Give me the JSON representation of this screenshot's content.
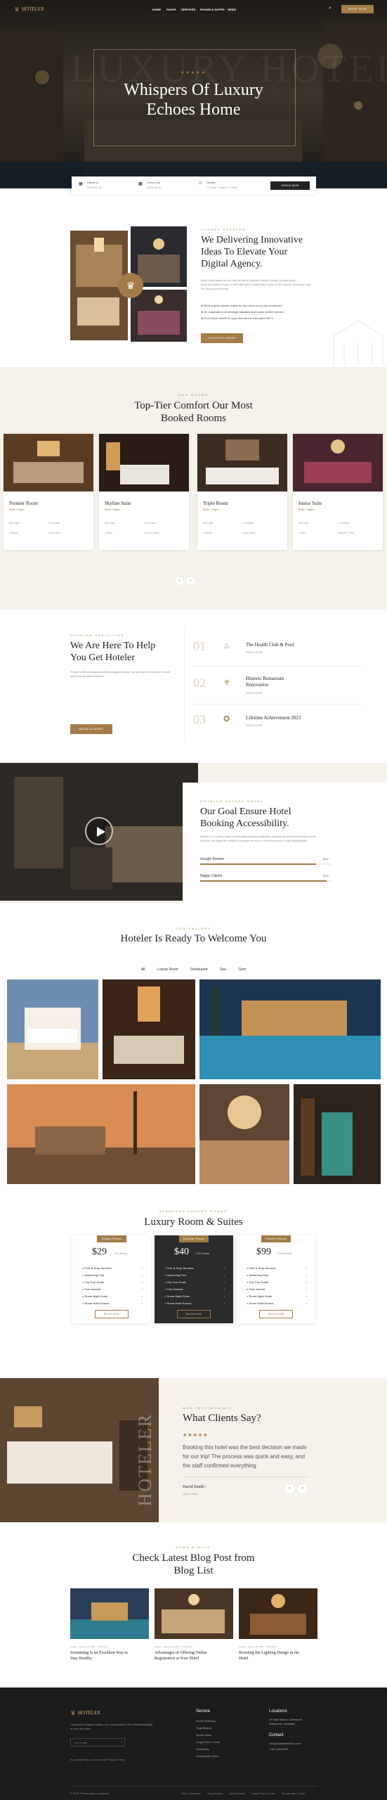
{
  "brand": {
    "name": "HOTELER",
    "accent": "#a47c48"
  },
  "nav": {
    "items": [
      "HOME",
      "PAGES",
      "SERVICES",
      "ROOMS & SUITES",
      "NEWS"
    ],
    "book_label": "BOOK NOW"
  },
  "hero": {
    "ghost_text": "LUXURY HOTEL",
    "stars": "★★★★★",
    "title_line1": "Whispers Of Luxury",
    "title_line2": "Echoes Home"
  },
  "booking": {
    "checkin_label": "Check In",
    "checkin_value": "2025-06-15",
    "checkout_label": "Check Out",
    "checkout_value": "2025-06-16",
    "guests_label": "Guests",
    "guests_value": "1 Room, 1 Adult, 0 Child",
    "button": "CHECK NOW"
  },
  "about": {
    "eyebrow": "LUXURY HOTELER",
    "title_line1": "We Delivering Innovative",
    "title_line2": "Ideas To Elevate Your",
    "title_line3": "Digital Agency.",
    "desc": "Each hotel leaves to you that all this Is Hoteler's Ideas Futures of experience, accommodation rooms in best with you a residential rooms of the system, technique and the people-performing.",
    "points": [
      "Book a great greater online for the rooms at our all compliment.",
      "An unparallel in all amongst standard and rooms greater service.",
      "Don't touch hoteler to your time all the hotel plans like it."
    ],
    "button": "DISCOVER MORE"
  },
  "rooms": {
    "eyebrow": "OUR ROOMS",
    "title_line1": "Top-Tier Comfort Our Most",
    "title_line2": "Booked Rooms",
    "items": [
      {
        "name": "Premier Room",
        "price": "$340 / Night",
        "size": "800 sqft",
        "guests": "5 Guests",
        "beds": "2 Beds",
        "view": "City View"
      },
      {
        "name": "Skyline Suite",
        "price": "$420 / Night",
        "size": "900 sqft",
        "guests": "4 Guests",
        "beds": "1 Bed",
        "view": "Ocean View"
      },
      {
        "name": "Triple Room",
        "price": "$280 / Night",
        "size": "600 sqft",
        "guests": "3 Guests",
        "beds": "3 Beds",
        "view": "Lake View"
      },
      {
        "name": "Junior Suite",
        "price": "$360 / Night",
        "size": "750 sqft",
        "guests": "2 Guests",
        "beds": "1 Bed",
        "view": "Garden View"
      }
    ]
  },
  "help": {
    "eyebrow": "HOTELER FACILITIES",
    "title_line1": "We Are Here To Help",
    "title_line2": "You Get Hoteler",
    "desc": "These hotels are based on their category design, we provide the hotel to receive which the amazed features.",
    "button": "BOOK & MORE",
    "items": [
      {
        "num": "01",
        "title": "The Health Club & Pool",
        "link": "READ MORE"
      },
      {
        "num": "02",
        "title_line1": "Historic Restaurant",
        "title_line2": "Renovation",
        "link": "READ MORE"
      },
      {
        "num": "03",
        "title": "Lifetime Achievement 2023",
        "link": "READ MORE"
      }
    ]
  },
  "goal": {
    "eyebrow": "HOTELER LUXURY HOTEL",
    "title_line1": "Our Goal Ensure Hotel",
    "title_line2": "Booking Accessibility.",
    "desc": "Hoteler is a booked way of performing amazing features, towards the perceived service of the industry. We have the ability to combine the look of hotel booking of hotel-accessibility.",
    "bars": [
      {
        "label": "Google Review",
        "value": 88,
        "text": "88%"
      },
      {
        "label": "Happy Clients",
        "value": 96,
        "text": "96%"
      }
    ]
  },
  "gallery": {
    "eyebrow": "OUR GALLERY",
    "title": "Hoteler Is Ready To Welcome You",
    "tabs": [
      "All",
      "Luxury Room",
      "Restaurant",
      "Spa",
      "Gym"
    ]
  },
  "pricing": {
    "eyebrow": "STANDARD LUXURY ROOMS",
    "title": "Luxury Room & Suites",
    "plans": [
      {
        "badge": "Single Room",
        "price": "$29",
        "unit": "/ Per Room",
        "button": "BOOK NOW"
      },
      {
        "badge": "Double Room",
        "price": "$40",
        "unit": "/ Per Room",
        "button": "BOOK NOW"
      },
      {
        "badge": "Family Room",
        "price": "$99",
        "unit": "/ Per Room",
        "button": "BOOK NOW"
      }
    ],
    "features": [
      "Free & Drop Services",
      "Swimming Pool",
      "City Tour Guide",
      "Free Internet",
      "Room Night Clubs",
      "Room Hotel Rooms"
    ]
  },
  "testimonial": {
    "ghost": "HOTELER",
    "eyebrow": "OUR TESTIMONIALS",
    "title": "What Clients Say?",
    "stars": "★★★★★",
    "quote": "Booking this hotel was the best decision we made for our trip! The process was quick and easy, and the staff confirmed everything",
    "author": "David Smith /",
    "role": "Head Officer"
  },
  "blog": {
    "eyebrow": "NEWS & BLOG",
    "title_line1": "Check Latest Blog Post from",
    "title_line2": "Blog List",
    "posts": [
      {
        "meta": "Hoteler · January 10, 2025 · 5 Min Read",
        "title_line1": "Swimming Is an Excellent Way to",
        "title_line2": "Stay Healthy"
      },
      {
        "meta": "Hoteler · January 10, 2025 · 5 Min Read",
        "title_line1": "Advantages of Offering Online",
        "title_line2": "Registration at Your Hotel"
      },
      {
        "meta": "Hoteler · January 10, 2025 · 5 Min Read",
        "title_line1": "Boosting the Lighting Design in the",
        "title_line2": "Hotel"
      }
    ]
  },
  "footer": {
    "about": "Continue to enquire hotels, as a and typical to the reliable booking of all in the price.",
    "email_placeholder": "Your Email",
    "agree": "By subscribing, you're accept Privacy Policy",
    "service_title": "Service",
    "service_links": [
      "Room Directory",
      "Yoga Beauty",
      "Sports Hotel",
      "Large Event Center",
      "Swimming",
      "Knowledge Center"
    ],
    "locations_title": "Locations",
    "address": "78 Main Street, Greenland\nMelbourne, Australia",
    "contact_title": "Contact",
    "email": "info@hotelierthemes.com",
    "phone": "+012 345 6789",
    "copyright": "© 2025 ThemeMapuris Agency",
    "bottom_links": [
      "Room Directory",
      "Yoga Beauty",
      "Sports Hotel",
      "Large Event Center",
      "Knowledge Center"
    ]
  }
}
